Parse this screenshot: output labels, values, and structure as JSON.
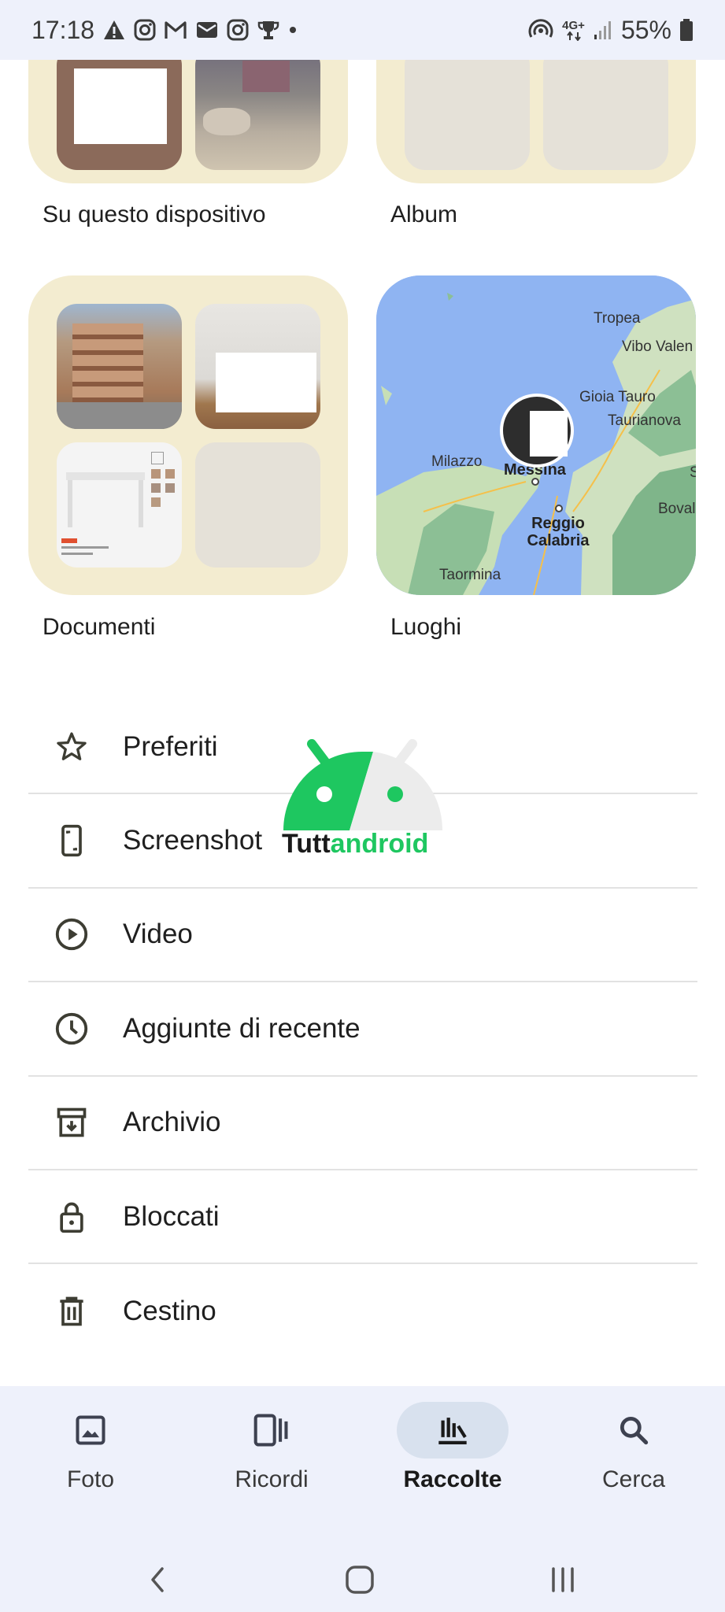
{
  "status": {
    "time": "17:18",
    "network": "4G+",
    "battery": "55%",
    "icons": [
      "warning-icon",
      "instagram-icon",
      "gmail-icon",
      "mail-icon",
      "instagram-icon",
      "trophy-icon",
      "dot-icon",
      "hotspot-icon",
      "signal-icon",
      "battery-icon"
    ]
  },
  "collections": [
    {
      "label": "Su questo dispositivo"
    },
    {
      "label": "Album"
    },
    {
      "label": "Documenti"
    },
    {
      "label": "Luoghi"
    }
  ],
  "map": {
    "places": [
      "Tropea",
      "Vibo Valen",
      "Gioia Tauro",
      "Taurianova",
      "Milazzo",
      "Messina",
      "Reggio Calabria",
      "Boval",
      "Taormina",
      "S"
    ]
  },
  "list": [
    {
      "label": "Preferiti",
      "icon": "star-icon"
    },
    {
      "label": "Screenshot",
      "icon": "screenshot-icon"
    },
    {
      "label": "Video",
      "icon": "play-icon"
    },
    {
      "label": "Aggiunte di recente",
      "icon": "clock-icon"
    },
    {
      "label": "Archivio",
      "icon": "archive-icon"
    },
    {
      "label": "Bloccati",
      "icon": "lock-icon"
    },
    {
      "label": "Cestino",
      "icon": "trash-icon"
    }
  ],
  "watermark": {
    "part1": "Tutt",
    "part2": "android"
  },
  "nav": [
    {
      "label": "Foto",
      "icon": "photo-icon",
      "active": false
    },
    {
      "label": "Ricordi",
      "icon": "memories-icon",
      "active": false
    },
    {
      "label": "Raccolte",
      "icon": "collections-icon",
      "active": true
    },
    {
      "label": "Cerca",
      "icon": "search-icon",
      "active": false
    }
  ],
  "colors": {
    "tile_bg": "#f3ecd0",
    "nav_bg": "#eef1fb",
    "active_pill": "#d8e1ee",
    "android_green": "#1ec760"
  }
}
